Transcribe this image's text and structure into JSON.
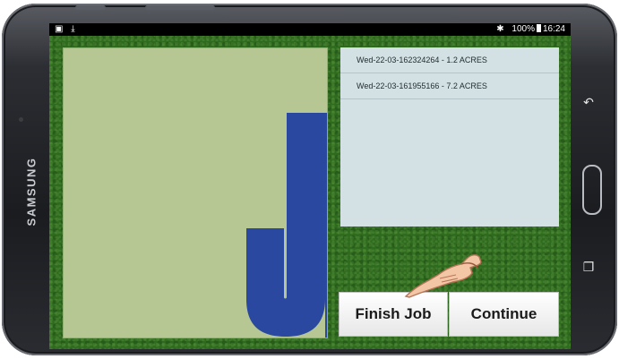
{
  "device": {
    "brand": "SAMSUNG",
    "keys": {
      "back_icon": "back-arrow-icon",
      "recents_icon": "recent-apps-icon"
    }
  },
  "statusbar": {
    "left_icons": [
      "screenshot-icon",
      "download-icon"
    ],
    "bluetooth_icon": "bluetooth-icon",
    "battery": "100%",
    "time": "16:24"
  },
  "field_map": {
    "label": "J",
    "colors": {
      "field": "#b6c794",
      "shape": "#2a48a0"
    }
  },
  "jobs": {
    "items": [
      {
        "label": "Wed-22-03-162324264 - 1.2 ACRES"
      },
      {
        "label": "Wed-22-03-161955166 - 7.2 ACRES"
      }
    ]
  },
  "actions": {
    "finish_label": "Finish Job",
    "continue_label": "Continue"
  }
}
